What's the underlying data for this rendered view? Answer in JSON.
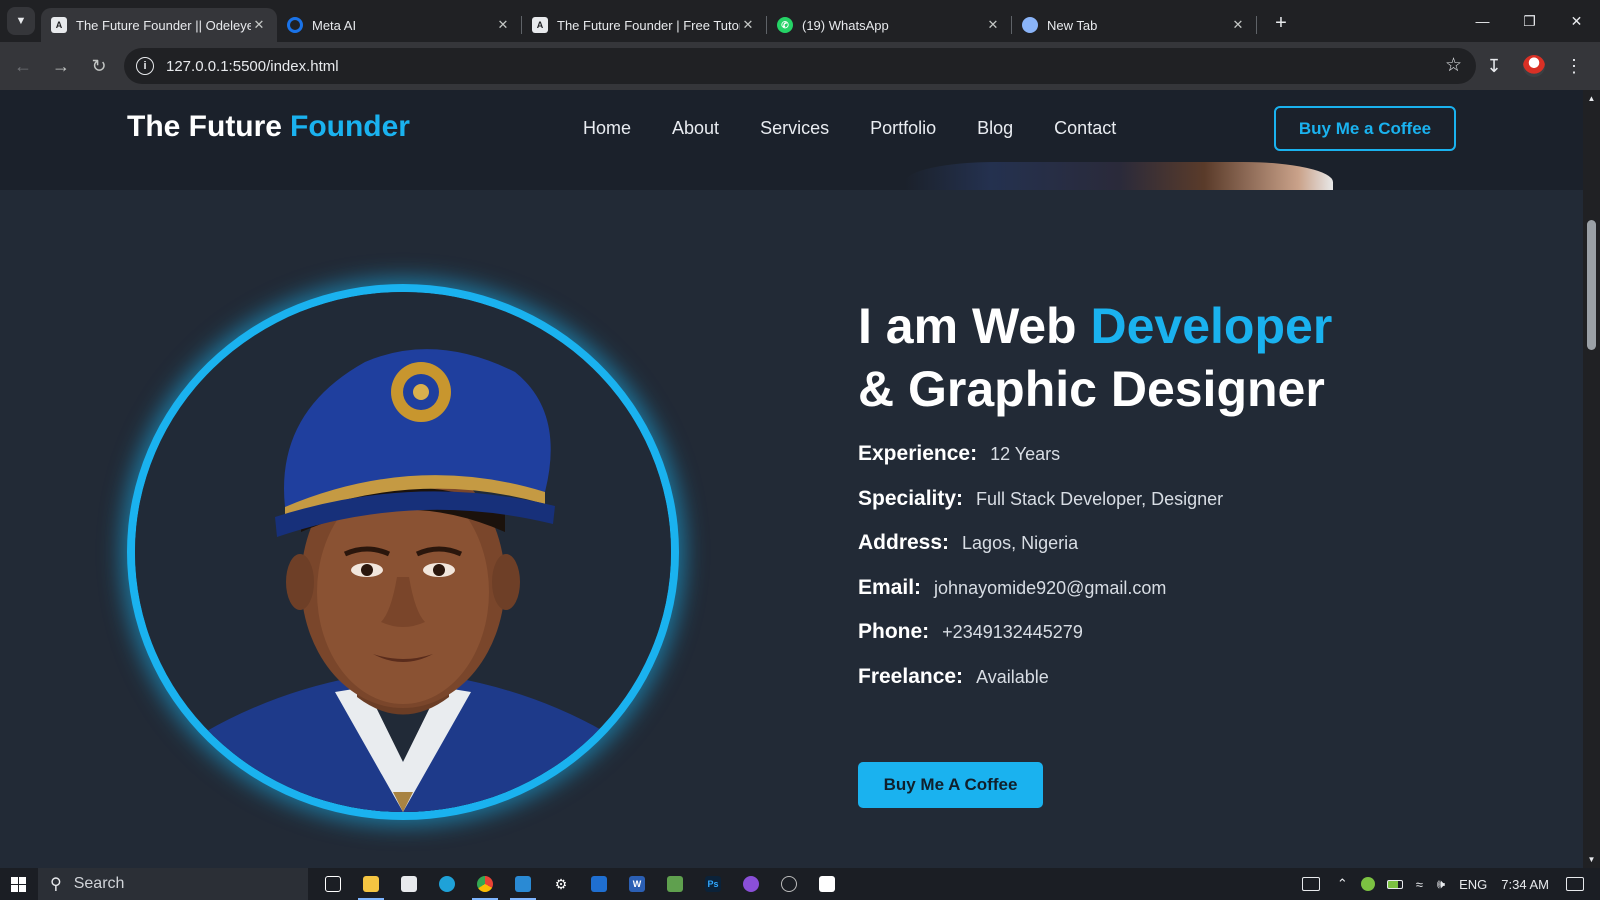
{
  "browser": {
    "tabs": [
      {
        "title": "The Future Founder || Odeleye J",
        "icon": "site-favicon",
        "active": true
      },
      {
        "title": "Meta AI",
        "icon": "meta-ai-icon",
        "active": false
      },
      {
        "title": "The Future Founder | Free Tutor",
        "icon": "site-favicon",
        "active": false
      },
      {
        "title": "(19) WhatsApp",
        "icon": "whatsapp-icon",
        "active": false
      },
      {
        "title": "New Tab",
        "icon": "chrome-icon",
        "active": false
      }
    ],
    "url": "127.0.0.1:5500/index.html"
  },
  "site": {
    "logo": {
      "part1": "The Future",
      "part2": "Founder"
    },
    "nav": [
      "Home",
      "About",
      "Services",
      "Portfolio",
      "Blog",
      "Contact"
    ],
    "header_cta": "Buy Me a Coffee",
    "hero": {
      "line1_prefix": "I am Web",
      "line1_accent": "Developer",
      "line2": "& Graphic Designer",
      "info": [
        {
          "label": "Experience:",
          "value": "12 Years"
        },
        {
          "label": "Speciality:",
          "value": "Full Stack Developer, Designer"
        },
        {
          "label": "Address:",
          "value": "Lagos, Nigeria"
        },
        {
          "label": "Email:",
          "value": "johnayomide920@gmail.com"
        },
        {
          "label": "Phone:",
          "value": "+2349132445279"
        },
        {
          "label": "Freelance:",
          "value": "Available"
        }
      ],
      "cta": "Buy Me A Coffee"
    },
    "colors": {
      "accent": "#1ab2ef",
      "background": "#222a36",
      "header_bg": "#1b212b"
    }
  },
  "taskbar": {
    "search_placeholder": "Search",
    "tray": {
      "language": "ENG",
      "time": "7:34 AM"
    }
  }
}
